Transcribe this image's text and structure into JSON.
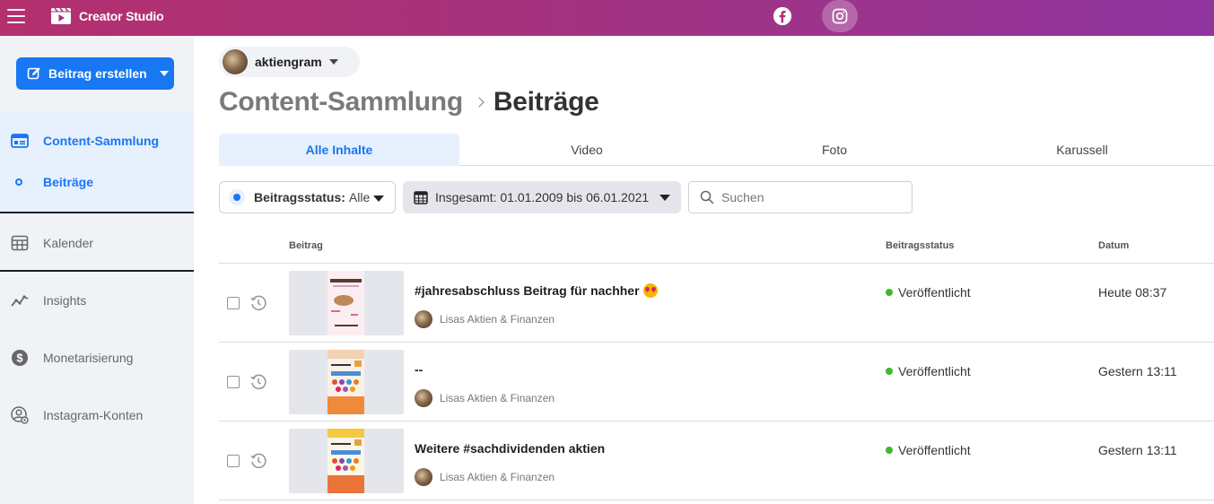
{
  "app": {
    "title": "Creator Studio"
  },
  "topbar": {
    "icons": [
      "menu-icon",
      "facebook-icon",
      "instagram-icon"
    ]
  },
  "sidebar": {
    "create_button": "Beitrag erstellen",
    "items": [
      {
        "label": "Content-Sammlung",
        "icon": "content-library-icon",
        "active": true
      },
      {
        "label": "Beiträge",
        "icon": "dot-icon",
        "active": true,
        "sub": true
      },
      {
        "label": "Kalender",
        "icon": "calendar-icon"
      },
      {
        "label": "Insights",
        "icon": "insights-icon"
      },
      {
        "label": "Monetarisierung",
        "icon": "dollar-icon"
      },
      {
        "label": "Instagram-Konten",
        "icon": "account-settings-icon"
      }
    ]
  },
  "main": {
    "account": "aktiengram",
    "breadcrumb": [
      "Content-Sammlung",
      "Beiträge"
    ],
    "tabs": [
      {
        "label": "Alle Inhalte",
        "active": true
      },
      {
        "label": "Video"
      },
      {
        "label": "Foto"
      },
      {
        "label": "Karussell"
      }
    ],
    "filters": {
      "status_label": "Beitragsstatus:",
      "status_value": "Alle",
      "date_value": "Insgesamt: 01.01.2009 bis 06.01.2021"
    },
    "search": {
      "placeholder": "Suchen"
    },
    "table": {
      "columns": [
        "Beitrag",
        "Beitragsstatus",
        "Datum"
      ],
      "rows": [
        {
          "title": "#jahresabschluss Beitrag für nachher",
          "author": "Lisas Aktien & Finanzen",
          "status": "Veröffentlicht",
          "date": "Heute 08:37"
        },
        {
          "title": "--",
          "author": "Lisas Aktien & Finanzen",
          "status": "Veröffentlicht",
          "date": "Gestern 13:11"
        },
        {
          "title": "Weitere #sachdividenden aktien",
          "author": "Lisas Aktien & Finanzen",
          "status": "Veröffentlicht",
          "date": "Gestern 13:11"
        }
      ]
    }
  },
  "colors": {
    "accent": "#1877f2",
    "published": "#42b72a",
    "topbar_start": "#b4306e",
    "topbar_end": "#8f35a0"
  }
}
